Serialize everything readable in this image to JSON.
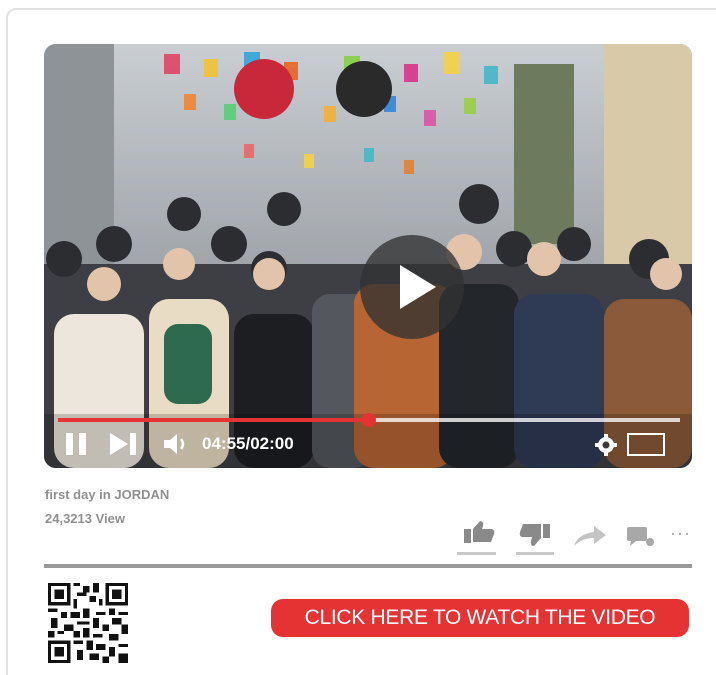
{
  "video": {
    "time_display": "04:55/02:00",
    "progress_fraction": 0.5
  },
  "info": {
    "title": "first day in JORDAN",
    "views": "24,3213 View"
  },
  "actions": {
    "more_label": "···"
  },
  "cta": {
    "label": "CLICK HERE TO WATCH THE VIDEO"
  },
  "colors": {
    "accent": "#e53232",
    "muted_text": "#909090",
    "icon_gray": "#8a8a8a",
    "divider": "#9a9a9a"
  },
  "icons": [
    "play-icon",
    "pause-icon",
    "next-icon",
    "volume-icon",
    "settings-icon",
    "fullscreen-icon",
    "like-icon",
    "dislike-icon",
    "share-icon",
    "comment-icon",
    "more-icon",
    "qr-code"
  ]
}
